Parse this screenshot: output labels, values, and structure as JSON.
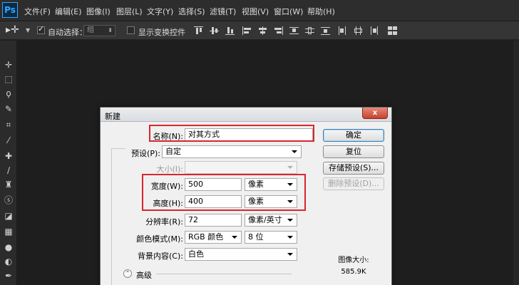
{
  "app": {
    "logo": "Ps"
  },
  "menu": [
    {
      "label": "文件(F)"
    },
    {
      "label": "编辑(E)"
    },
    {
      "label": "图像(I)"
    },
    {
      "label": "图层(L)"
    },
    {
      "label": "文字(Y)"
    },
    {
      "label": "选择(S)"
    },
    {
      "label": "滤镜(T)"
    },
    {
      "label": "视图(V)"
    },
    {
      "label": "窗口(W)"
    },
    {
      "label": "帮助(H)"
    }
  ],
  "options_bar": {
    "tool_icon": "move-tool-icon",
    "auto_select_label": "自动选择：",
    "auto_select_checked": true,
    "auto_select_value": "组",
    "show_transform_label": "显示变换控件",
    "show_transform_checked": false
  },
  "tools": [
    "move",
    "marquee",
    "lasso",
    "quick-select",
    "crop",
    "eyedropper",
    "healing",
    "brush",
    "stamp",
    "history-brush",
    "eraser",
    "gradient",
    "blur",
    "dodge",
    "pen"
  ],
  "dialog": {
    "title": "新建",
    "close_glyph": "x",
    "name_label": "名称(N):",
    "name_value": "对其方式",
    "preset_label": "预设(P):",
    "preset_value": "自定",
    "size_label": "大小(I):",
    "size_value": "",
    "width_label": "宽度(W):",
    "width_value": "500",
    "width_unit": "像素",
    "height_label": "高度(H):",
    "height_value": "400",
    "height_unit": "像素",
    "resolution_label": "分辨率(R):",
    "resolution_value": "72",
    "resolution_unit": "像素/英寸",
    "colormode_label": "颜色模式(M):",
    "colormode_value": "RGB 颜色",
    "bitdepth_value": "8 位",
    "background_label": "背景内容(C):",
    "background_value": "白色",
    "advanced_label": "高级",
    "buttons": {
      "ok": "确定",
      "reset": "复位",
      "save_preset": "存储预设(S)...",
      "delete_preset": "删除预设(D)..."
    },
    "image_size_label": "图像大小:",
    "image_size_value": "585.9K"
  },
  "colors": {
    "highlight": "#d8262f",
    "default_button": "#3c7fb1"
  }
}
